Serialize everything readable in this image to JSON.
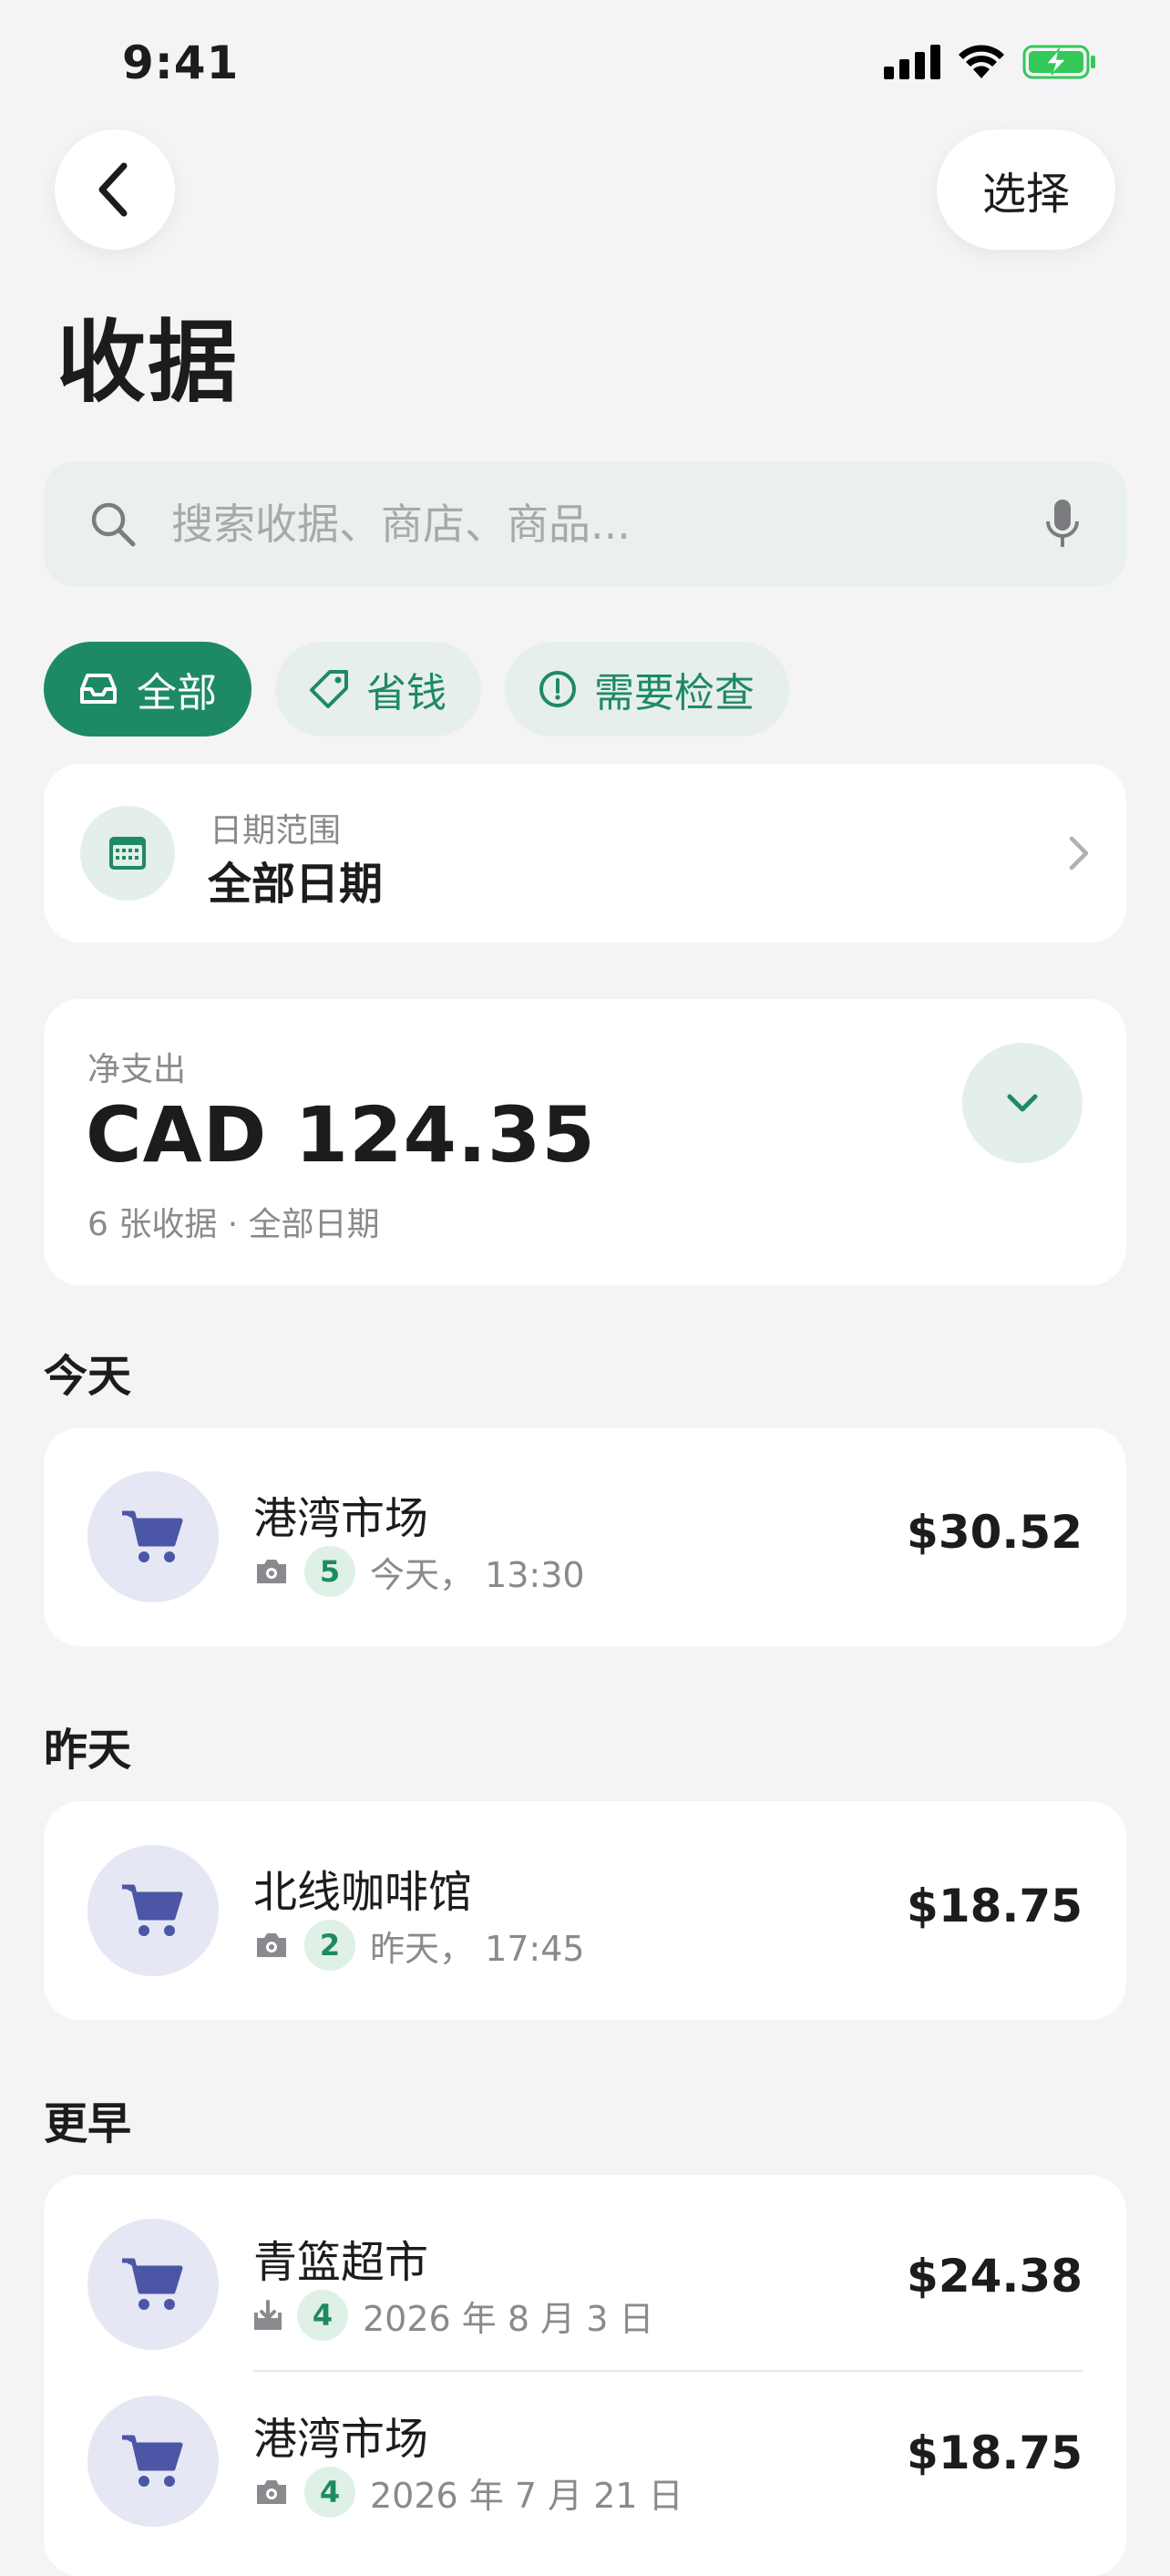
{
  "status_bar": {
    "time": "9:41"
  },
  "nav": {
    "select_label": "选择"
  },
  "page_title": "收据",
  "search": {
    "placeholder": "搜索收据、商店、商品..."
  },
  "filters": [
    {
      "label": "全部",
      "icon": "inbox-icon",
      "active": true
    },
    {
      "label": "省钱",
      "icon": "tag-icon",
      "active": false
    },
    {
      "label": "需要检查",
      "icon": "alert-circle-icon",
      "active": false
    }
  ],
  "date_range": {
    "label": "日期范围",
    "value": "全部日期"
  },
  "spending": {
    "label": "净支出",
    "amount": "CAD 124.35",
    "subtitle": "6 张收据 · 全部日期"
  },
  "sections": [
    {
      "title": "今天",
      "receipts": [
        {
          "merchant": "港湾市场",
          "source_icon": "camera-icon",
          "items": "5",
          "date": "今天， 13:30",
          "amount": "$30.52"
        }
      ]
    },
    {
      "title": "昨天",
      "receipts": [
        {
          "merchant": "北线咖啡馆",
          "source_icon": "camera-icon",
          "items": "2",
          "date": "昨天， 17:45",
          "amount": "$18.75"
        }
      ]
    },
    {
      "title": "更早",
      "receipts": [
        {
          "merchant": "青篮超市",
          "source_icon": "import-icon",
          "items": "4",
          "date": "2026 年 8 月 3 日",
          "amount": "$24.38"
        },
        {
          "merchant": "港湾市场",
          "source_icon": "camera-icon",
          "items": "4",
          "date": "2026 年 7 月 21 日",
          "amount": "$18.75"
        }
      ]
    }
  ],
  "colors": {
    "accent": "#1e8a64",
    "background": "#f4f4f6",
    "avatar_bg": "#e5e7f4",
    "cart": "#4b56a6"
  }
}
